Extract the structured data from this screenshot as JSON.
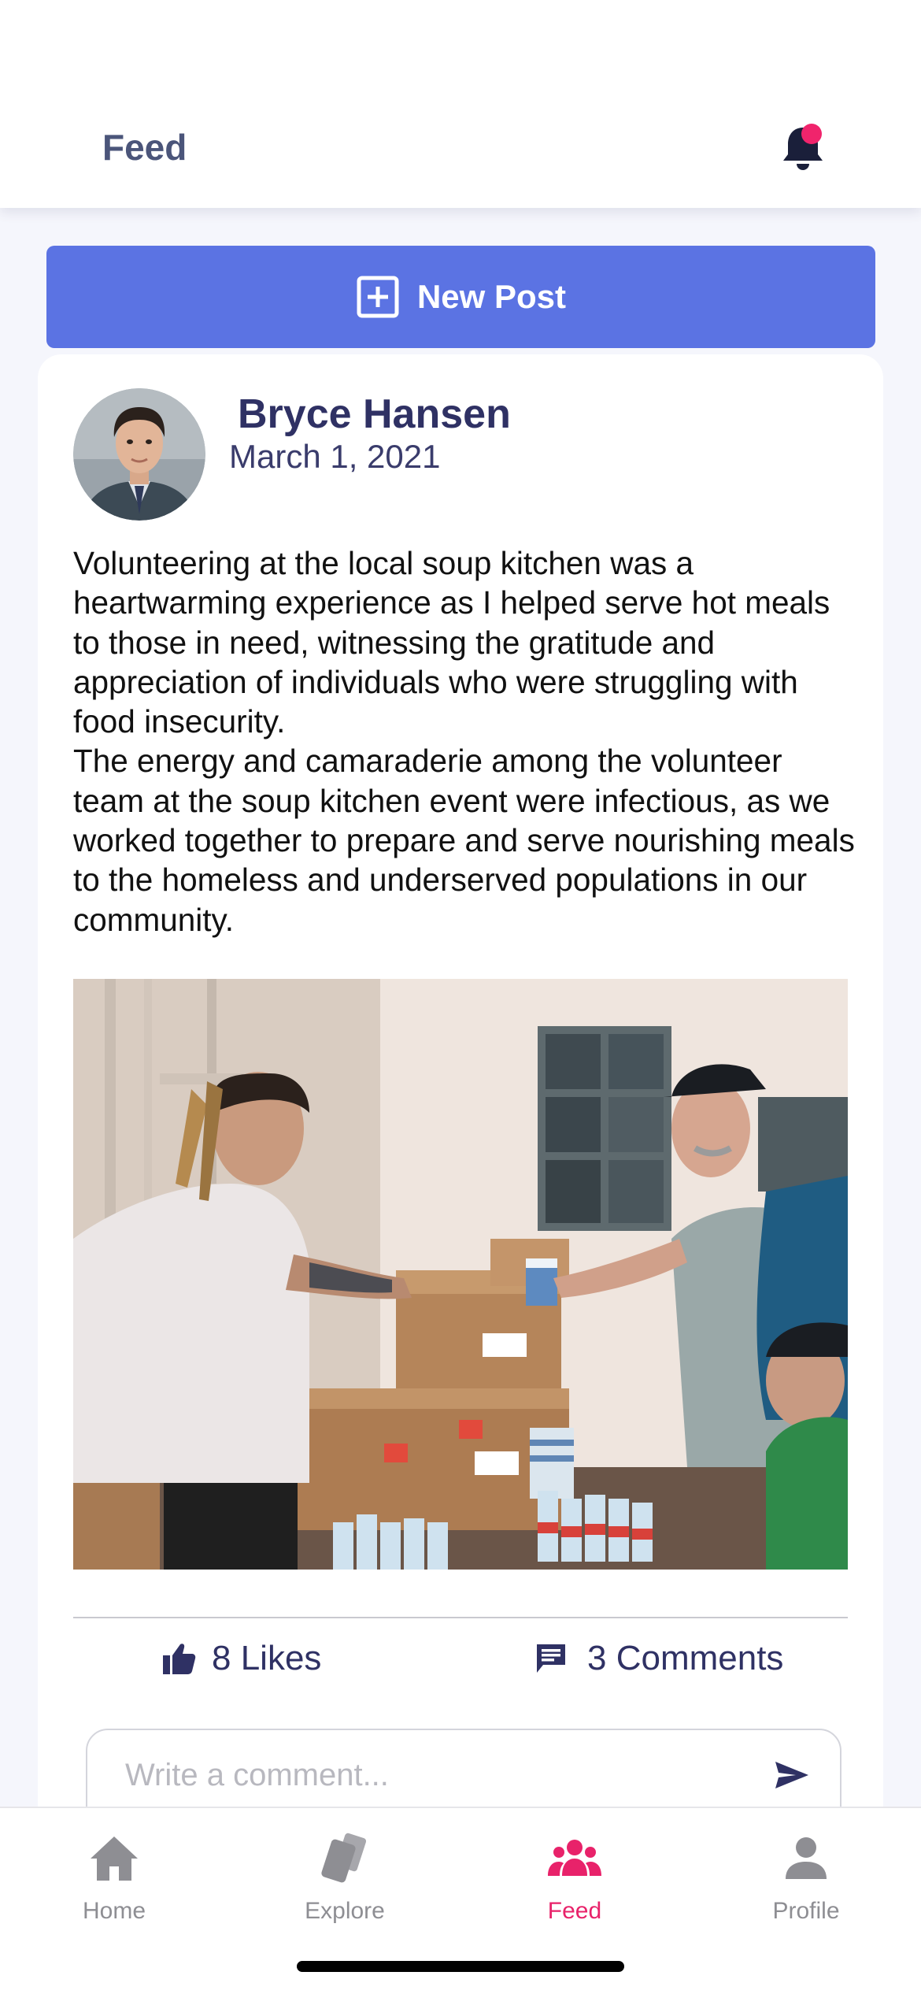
{
  "header": {
    "title": "Feed",
    "notification_icon": "bell-icon",
    "has_unread": true
  },
  "new_post": {
    "label": "New Post",
    "icon": "plus-square-icon"
  },
  "post": {
    "author": "Bryce Hansen",
    "date": "March 1, 2021",
    "paragraphs": [
      "Volunteering at the local soup kitchen was a heartwarming experience as I helped serve hot meals to those in need, witnessing the gratitude and appreciation of individuals who were struggling with food insecurity.",
      "The energy and camaraderie among the volunteer team at the soup kitchen event were infectious, as we worked together to prepare and serve nourishing meals to the homeless and underserved populations in our community."
    ],
    "likes_label": "8 Likes",
    "comments_label": "3 Comments",
    "comment_placeholder": "Write a comment..."
  },
  "tabs": [
    {
      "label": "Home",
      "icon": "home-icon",
      "active": false
    },
    {
      "label": "Explore",
      "icon": "cards-icon",
      "active": false
    },
    {
      "label": "Feed",
      "icon": "people-icon",
      "active": true
    },
    {
      "label": "Profile",
      "icon": "person-icon",
      "active": false
    }
  ],
  "colors": {
    "accent": "#5b73e3",
    "active_tab": "#e8226a",
    "inactive_tab": "#8e8e93",
    "text_dark": "#2f3164",
    "notification_dot": "#f0246c"
  }
}
